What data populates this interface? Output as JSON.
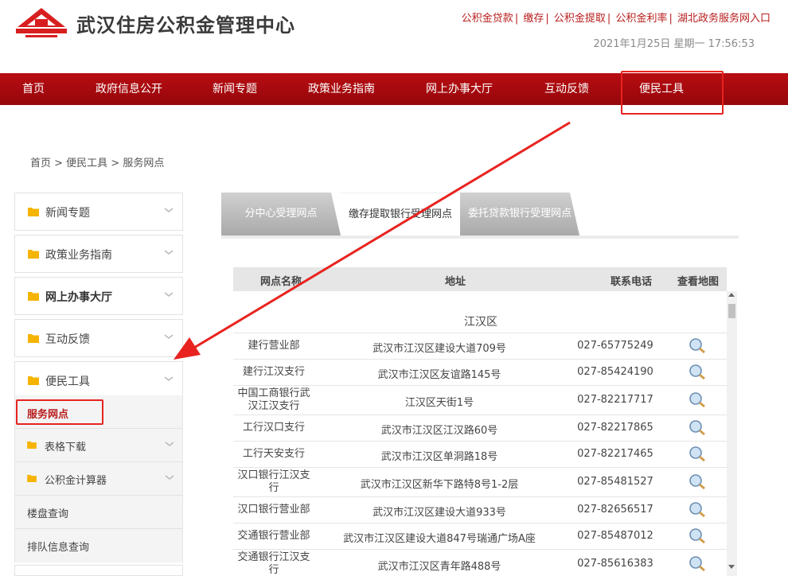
{
  "header": {
    "title": "武汉住房公积金管理中心",
    "links": [
      "公积金贷款",
      "缴存",
      "公积金提取",
      "公积金利率",
      "湖北政务服务网入口"
    ],
    "datetime": "2021年1月25日 星期一 17:56:53"
  },
  "nav": [
    "首页",
    "政府信息公开",
    "新闻专题",
    "政策业务指南",
    "网上办事大厅",
    "互动反馈",
    "便民工具"
  ],
  "breadcrumb": "首页 > 便民工具 > 服务网点",
  "sidebar": {
    "sections": [
      "新闻专题",
      "政策业务指南",
      "网上办事大厅",
      "互动反馈",
      "便民工具"
    ],
    "active": "服务网点",
    "sub_items": [
      "表格下载",
      "公积金计算器",
      "楼盘查询",
      "排队信息查询"
    ]
  },
  "tabs": [
    "分中心受理网点",
    "缴存提取银行受理网点",
    "委托贷款银行受理网点"
  ],
  "table": {
    "headers": [
      "网点名称",
      "地址",
      "联系电话",
      "查看地图"
    ],
    "district": "江汉区",
    "rows": [
      {
        "name": "建行营业部",
        "address": "武汉市江汉区建设大道709号",
        "phone": "027-65775249"
      },
      {
        "name": "建行江汉支行",
        "address": "武汉市江汉区友谊路145号",
        "phone": "027-85424190"
      },
      {
        "name": "中国工商银行武汉江汉支行",
        "address": "江汉区天街1号",
        "phone": "027-82217717"
      },
      {
        "name": "工行汉口支行",
        "address": "武汉市江汉区江汉路60号",
        "phone": "027-82217865"
      },
      {
        "name": "工行天安支行",
        "address": "武汉市江汉区单洞路18号",
        "phone": "027-82217465"
      },
      {
        "name": "汉口银行江汉支行",
        "address": "武汉市江汉区新华下路特8号1-2层",
        "phone": "027-85481527"
      },
      {
        "name": "汉口银行营业部",
        "address": "武汉市江汉区建设大道933号",
        "phone": "027-82656517"
      },
      {
        "name": "交通银行营业部",
        "address": "武汉市江汉区建设大道847号瑞通广场A座",
        "phone": "027-85487012"
      },
      {
        "name": "交通银行江汉支行",
        "address": "武汉市江汉区青年路488号",
        "phone": "027-85616383"
      }
    ]
  },
  "colors": {
    "brand_red": "#b80d12",
    "highlight": "#e8231f",
    "folder": "#f5b400"
  }
}
